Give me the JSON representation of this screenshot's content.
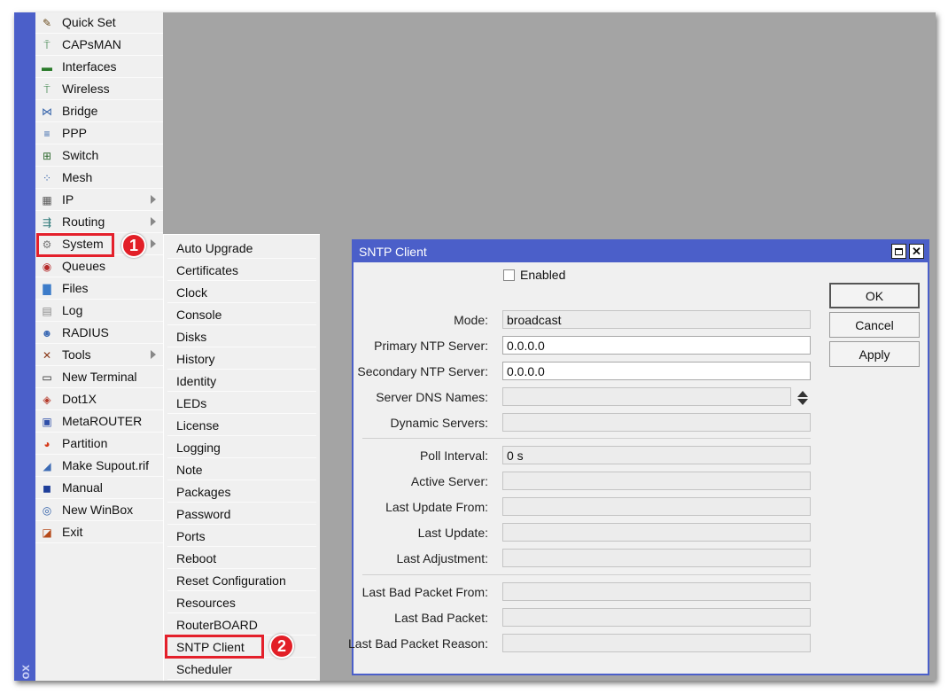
{
  "brand": "ox",
  "sidebar": {
    "items": [
      {
        "label": "Quick Set",
        "icon": "wand-icon",
        "submenu": false
      },
      {
        "label": "CAPsMAN",
        "icon": "antenna-icon",
        "submenu": false
      },
      {
        "label": "Interfaces",
        "icon": "interfaces-icon",
        "submenu": false
      },
      {
        "label": "Wireless",
        "icon": "wireless-icon",
        "submenu": false
      },
      {
        "label": "Bridge",
        "icon": "bridge-icon",
        "submenu": false
      },
      {
        "label": "PPP",
        "icon": "ppp-icon",
        "submenu": false
      },
      {
        "label": "Switch",
        "icon": "switch-icon",
        "submenu": false
      },
      {
        "label": "Mesh",
        "icon": "mesh-icon",
        "submenu": false
      },
      {
        "label": "IP",
        "icon": "ip-icon",
        "submenu": true
      },
      {
        "label": "Routing",
        "icon": "routing-icon",
        "submenu": true
      },
      {
        "label": "System",
        "icon": "gear-icon",
        "submenu": true
      },
      {
        "label": "Queues",
        "icon": "queues-icon",
        "submenu": false
      },
      {
        "label": "Files",
        "icon": "folder-icon",
        "submenu": false
      },
      {
        "label": "Log",
        "icon": "log-icon",
        "submenu": false
      },
      {
        "label": "RADIUS",
        "icon": "users-icon",
        "submenu": false
      },
      {
        "label": "Tools",
        "icon": "tools-icon",
        "submenu": true
      },
      {
        "label": "New Terminal",
        "icon": "terminal-icon",
        "submenu": false
      },
      {
        "label": "Dot1X",
        "icon": "dot1x-icon",
        "submenu": false
      },
      {
        "label": "MetaROUTER",
        "icon": "metarouter-icon",
        "submenu": false
      },
      {
        "label": "Partition",
        "icon": "partition-icon",
        "submenu": false
      },
      {
        "label": "Make Supout.rif",
        "icon": "supout-icon",
        "submenu": false
      },
      {
        "label": "Manual",
        "icon": "manual-icon",
        "submenu": false
      },
      {
        "label": "New WinBox",
        "icon": "winbox-icon",
        "submenu": false
      },
      {
        "label": "Exit",
        "icon": "exit-icon",
        "submenu": false
      }
    ]
  },
  "system_submenu": {
    "items": [
      "Auto Upgrade",
      "Certificates",
      "Clock",
      "Console",
      "Disks",
      "History",
      "Identity",
      "LEDs",
      "License",
      "Logging",
      "Note",
      "Packages",
      "Password",
      "Ports",
      "Reboot",
      "Reset Configuration",
      "Resources",
      "RouterBOARD",
      "SNTP Client",
      "Scheduler"
    ]
  },
  "annotations": {
    "step1": "1",
    "step2": "2"
  },
  "dialog": {
    "title": "SNTP Client",
    "enabled_label": "Enabled",
    "enabled": false,
    "fields_a": [
      {
        "label": "Mode:",
        "value": "broadcast",
        "editable": false
      },
      {
        "label": "Primary NTP Server:",
        "value": "0.0.0.0",
        "editable": true
      },
      {
        "label": "Secondary NTP Server:",
        "value": "0.0.0.0",
        "editable": true
      },
      {
        "label": "Server DNS Names:",
        "value": "",
        "editable": false
      },
      {
        "label": "Dynamic Servers:",
        "value": "",
        "editable": false
      }
    ],
    "fields_b": [
      {
        "label": "Poll Interval:",
        "value": "0 s"
      },
      {
        "label": "Active Server:",
        "value": ""
      },
      {
        "label": "Last Update From:",
        "value": ""
      },
      {
        "label": "Last Update:",
        "value": ""
      },
      {
        "label": "Last Adjustment:",
        "value": ""
      }
    ],
    "fields_c": [
      {
        "label": "Last Bad Packet From:",
        "value": ""
      },
      {
        "label": "Last Bad Packet:",
        "value": ""
      },
      {
        "label": "Last Bad Packet Reason:",
        "value": ""
      }
    ],
    "buttons": {
      "ok": "OK",
      "cancel": "Cancel",
      "apply": "Apply"
    }
  }
}
